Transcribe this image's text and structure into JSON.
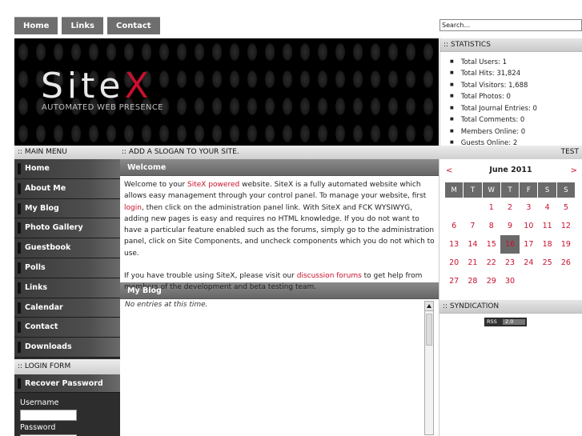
{
  "topnav": {
    "items": [
      "Home",
      "Links",
      "Contact"
    ]
  },
  "search": {
    "placeholder": "Search..."
  },
  "banner": {
    "logo_main": "Site",
    "logo_accent": "X",
    "tagline": "AUTOMATED WEB PRESENCE"
  },
  "statistics": {
    "title": ":: STATISTICS",
    "items": [
      "Total Users: 1",
      "Total Hits: 31,824",
      "Total Visitors: 1,688",
      "Total Photos: 0",
      "Total Journal Entries: 0",
      "Total Comments: 0",
      "Members Online: 0",
      "Guests Online: 2"
    ]
  },
  "slogan_bar": {
    "main_menu": ":: MAIN MENU",
    "slogan": ":: ADD A SLOGAN TO YOUR SITE.",
    "right": "TEST"
  },
  "main_menu": [
    "Home",
    "About Me",
    "My Blog",
    "Photo Gallery",
    "Guestbook",
    "Polls",
    "Links",
    "Calendar",
    "Contact",
    "Downloads"
  ],
  "login": {
    "title": ":: LOGIN FORM",
    "recover": "Recover Password",
    "username_label": "Username",
    "password_label": "Password"
  },
  "welcome": {
    "title": "Welcome",
    "p1_a": "Welcome to your ",
    "p1_link1": "SiteX powered",
    "p1_b": " website. SiteX is a fully automated website which allows easy management through your control panel. To manage your website, first ",
    "p1_link2": "login",
    "p1_c": ", then click on the administration panel link. With SiteX and FCK WYSIWYG, adding new pages is easy and requires no HTML knowledge. If you do not want to have a particular feature enabled such as the forums, simply go to the administration panel, click on Site Components, and uncheck components which you do not which to use.",
    "p2_a": "If you have trouble using SiteX, please visit our ",
    "p2_link": "discussion forums",
    "p2_b": " to get help from members of the development and beta testing team."
  },
  "blog": {
    "title": "My Blog",
    "empty": "No entries at this time."
  },
  "calendar": {
    "prev": "<",
    "next": ">",
    "month": "June 2011",
    "weekdays": [
      "M",
      "T",
      "W",
      "T",
      "F",
      "S",
      "S"
    ],
    "weeks": [
      [
        "",
        "",
        "1",
        "2",
        "3",
        "4",
        "5"
      ],
      [
        "6",
        "7",
        "8",
        "9",
        "10",
        "11",
        "12"
      ],
      [
        "13",
        "14",
        "15",
        "16",
        "17",
        "18",
        "19"
      ],
      [
        "20",
        "21",
        "22",
        "23",
        "24",
        "25",
        "26"
      ],
      [
        "27",
        "28",
        "29",
        "30",
        "",
        "",
        ""
      ]
    ],
    "today": "16"
  },
  "syndication": {
    "title": ":: SYNDICATION",
    "badge_left": "RSS",
    "badge_right": "2.0"
  }
}
